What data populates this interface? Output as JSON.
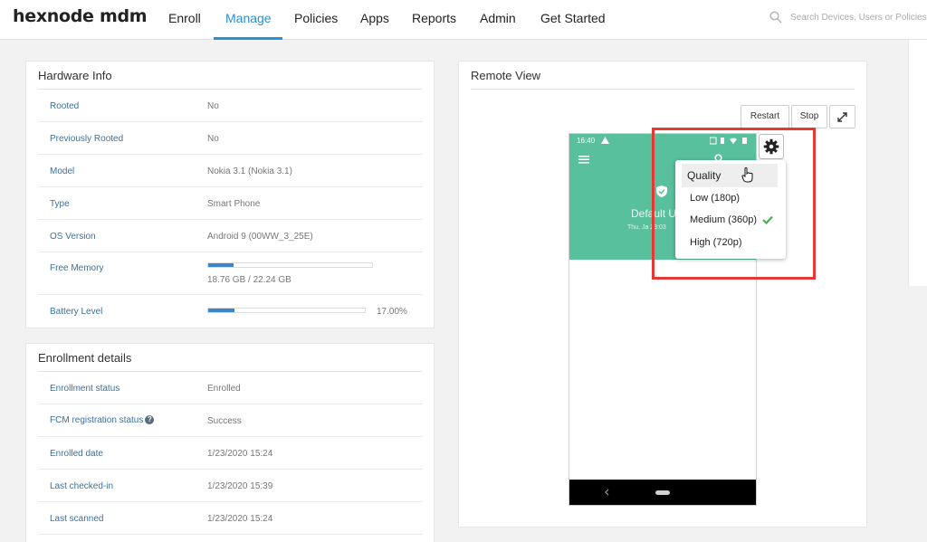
{
  "nav": {
    "logo": "hexnode mdm",
    "items": [
      "Enroll",
      "Manage",
      "Policies",
      "Apps",
      "Reports",
      "Admin",
      "Get Started"
    ],
    "active": "Manage",
    "search_placeholder": "Search Devices, Users or Policies"
  },
  "hardware": {
    "title": "Hardware Info",
    "rows": [
      {
        "label": "Rooted",
        "value": "No"
      },
      {
        "label": "Previously Rooted",
        "value": "No"
      },
      {
        "label": "Model",
        "value": "Nokia 3.1 (Nokia 3.1)"
      },
      {
        "label": "Type",
        "value": "Smart Phone"
      },
      {
        "label": "OS Version",
        "value": "Android 9 (00WW_3_25E)"
      }
    ],
    "free_memory": {
      "label": "Free Memory",
      "text": "18.76 GB / 22.24 GB",
      "fraction": 0.157
    },
    "battery": {
      "label": "Battery Level",
      "text": "17.00%",
      "fraction": 0.17
    }
  },
  "enrollment": {
    "title": "Enrollment details",
    "rows": [
      {
        "label": "Enrollment status",
        "value": "Enrolled"
      },
      {
        "label": "FCM registration status",
        "value": "Success"
      },
      {
        "label": "Enrolled date",
        "value": "1/23/2020 15:24"
      },
      {
        "label": "Last checked-in",
        "value": "1/23/2020 15:39"
      },
      {
        "label": "Last scanned",
        "value": "1/23/2020 15:24"
      }
    ]
  },
  "remote": {
    "title": "Remote View",
    "restart_label": "Restart",
    "stop_label": "Stop",
    "phone": {
      "time": "16:40",
      "center_text": "Default U",
      "date_text": "Thu, Ja  23:03"
    },
    "quality_menu": {
      "header": "Quality",
      "options": [
        "Low (180p)",
        "Medium (360p)",
        "High (720p)"
      ],
      "selected": "Medium (360p)"
    }
  },
  "colors": {
    "accent": "#2b8fd6",
    "phone_green": "#58c09c",
    "highlight": "#e53935",
    "check": "#3cb44b"
  }
}
